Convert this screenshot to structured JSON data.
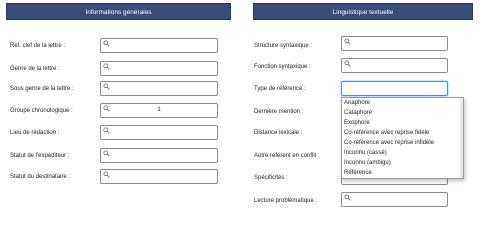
{
  "left_panel": {
    "title": "Informations générales",
    "fields": [
      {
        "label": "Ref. clef de la lettre :",
        "value": ""
      },
      {
        "label": "Genre de la lettre :",
        "value": ""
      },
      {
        "label": "Sous genre de la lettre :",
        "value": ""
      },
      {
        "label": "Groupe chronologique :",
        "value": "1"
      },
      {
        "label": "Lieu de rédaction :",
        "value": ""
      },
      {
        "label": "Statut de l'expéditeur :",
        "value": ""
      },
      {
        "label": "Statut du destinataire :",
        "value": ""
      }
    ]
  },
  "right_panel": {
    "title": "Linguistique textuelle",
    "fields": [
      {
        "label": "Structure syntaxique :",
        "value": ""
      },
      {
        "label": "Fonction syntaxique :",
        "value": ""
      },
      {
        "label": "Type de référence :",
        "value": ""
      },
      {
        "label": "Dernière mention :",
        "value": ""
      },
      {
        "label": "Distance lexicale :",
        "value": ""
      },
      {
        "label": "Autre référent en conflit :",
        "value": ""
      },
      {
        "label": "Spécificités :",
        "value": ""
      },
      {
        "label": "Lecture problématique :",
        "value": ""
      }
    ],
    "dropdown_options": [
      "Anaphore",
      "Cataphore",
      "Exophore",
      "Co-référence avec reprise fidèle",
      "Co-référence avec reprise infidèle",
      "Inconnu (cassé)",
      "Inconnu (ambigu)",
      "Référence"
    ]
  },
  "icons": {
    "field_icon": "magnifier-icon"
  },
  "colors": {
    "header_bg": "#3a4c78",
    "header_text": "#ffffff",
    "focus_border": "#4a8fd8"
  }
}
